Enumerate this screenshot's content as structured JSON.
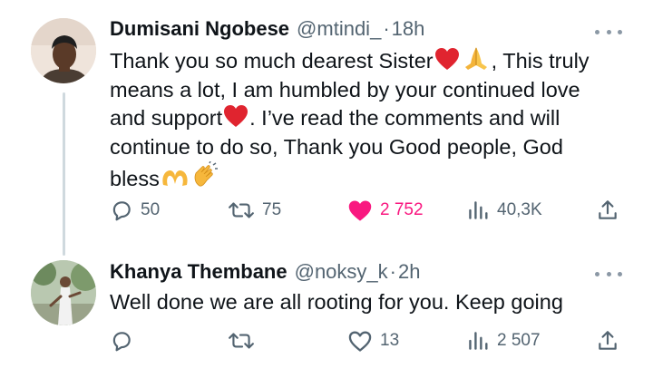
{
  "tweets": [
    {
      "author_name": "Dumisani Ngobese",
      "handle": "@mtindi_",
      "separator": "·",
      "time": "18h",
      "text_lines": [
        "Thank you so much dearest Sister",
        ", This truly",
        "means a lot, I am humbled by your continued love",
        "and support",
        ". I’ve read the comments and will",
        "continue to do so, Thank you Good people, God",
        "bless"
      ],
      "emojis": [
        "red-heart-emoji",
        "folded-hands-emoji",
        "red-heart-emoji",
        "heart-hands-emoji",
        "clapping-hands-emoji"
      ],
      "replies": "50",
      "reposts": "75",
      "likes": "2 752",
      "views": "40,3K",
      "liked": true
    },
    {
      "author_name": "Khanya Thembane",
      "handle": "@noksy_k",
      "separator": "·",
      "time": "2h",
      "text": "Well done we are all rooting for you. Keep going",
      "replies": "",
      "reposts": "",
      "likes": "13",
      "views": "2 507",
      "liked": false
    }
  ],
  "colors": {
    "text": "#0f1419",
    "secondary": "#536471",
    "like": "#f91880",
    "thread_line": "#cfd9de"
  }
}
